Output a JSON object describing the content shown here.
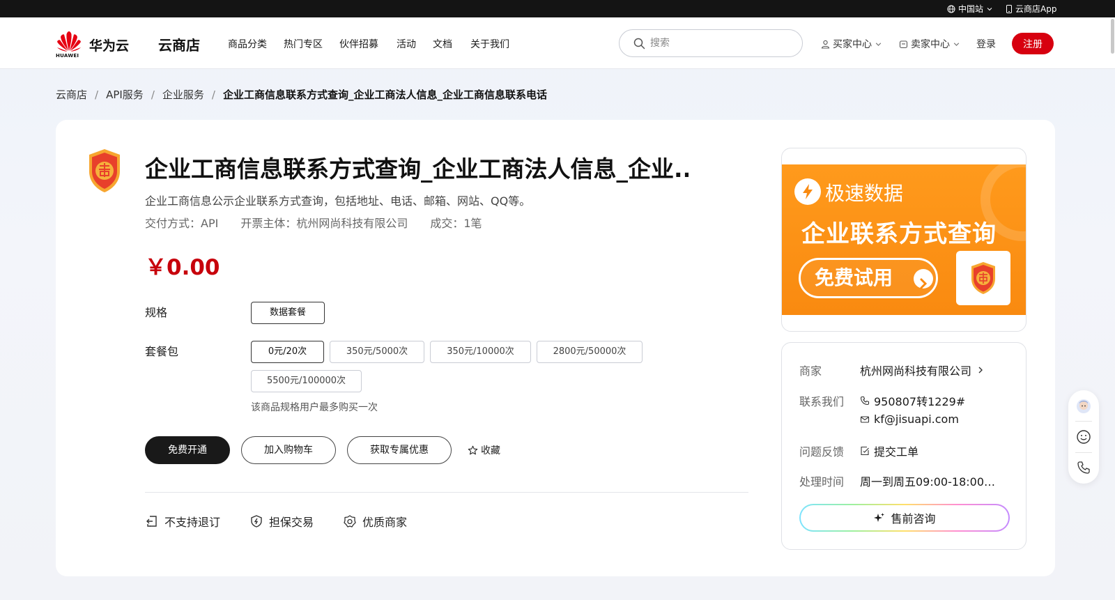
{
  "topbar": {
    "site_label": "中国站",
    "app_label": "云商店App"
  },
  "header": {
    "brand_name": "华为云",
    "brand_word": "HUAWEI",
    "store_title": "云商店",
    "nav": [
      "商品分类",
      "热门专区",
      "伙伴招募",
      "活动",
      "文档",
      "关于我们"
    ],
    "search_placeholder": "搜索",
    "buyer_center": "买家中心",
    "seller_center": "卖家中心",
    "login": "登录",
    "register": "注册"
  },
  "breadcrumb": [
    "云商店",
    "API服务",
    "企业服务",
    "企业工商信息联系方式查询_企业工商法人信息_企业工商信息联系电话"
  ],
  "breadcrumb_sep": "/",
  "product": {
    "title": "企业工商信息联系方式查询_企业工商法人信息_企业...",
    "description": "企业工商信息公示企业联系方式查询，包括地址、电话、邮箱、网站、QQ等。",
    "delivery": "交付方式：API",
    "invoice": "开票主体：杭州网尚科技有限公司",
    "deals": "成交：1笔",
    "price": "￥0.00",
    "spec_label": "规格",
    "spec_options": [
      "数据套餐"
    ],
    "package_label": "套餐包",
    "package_options": [
      "0元/20次",
      "350元/5000次",
      "350元/10000次",
      "2800元/50000次",
      "5500元/100000次"
    ],
    "limit_note": "该商品规格用户最多购买一次",
    "btn_free": "免费开通",
    "btn_cart": "加入购物车",
    "btn_discount": "获取专属优惠",
    "btn_fav": "收藏",
    "features": [
      "不支持退订",
      "担保交易",
      "优质商家"
    ]
  },
  "banner": {
    "brand": "极速数据",
    "headline": "企业联系方式查询",
    "cta": "免费试用",
    "accent": "#f98a10"
  },
  "seller": {
    "merchant_label": "商家",
    "merchant_name": "杭州网尚科技有限公司",
    "contact_label": "联系我们",
    "phone": "950807转1229#",
    "email": "kf@jisuapi.com",
    "feedback_label": "问题反馈",
    "feedback_action": "提交工单",
    "hours_label": "处理时间",
    "hours": "周一到周五09:00-18:00…",
    "consult": "售前咨询"
  },
  "colors": {
    "brand_red": "#d7000f",
    "price_red": "#c7000b"
  }
}
